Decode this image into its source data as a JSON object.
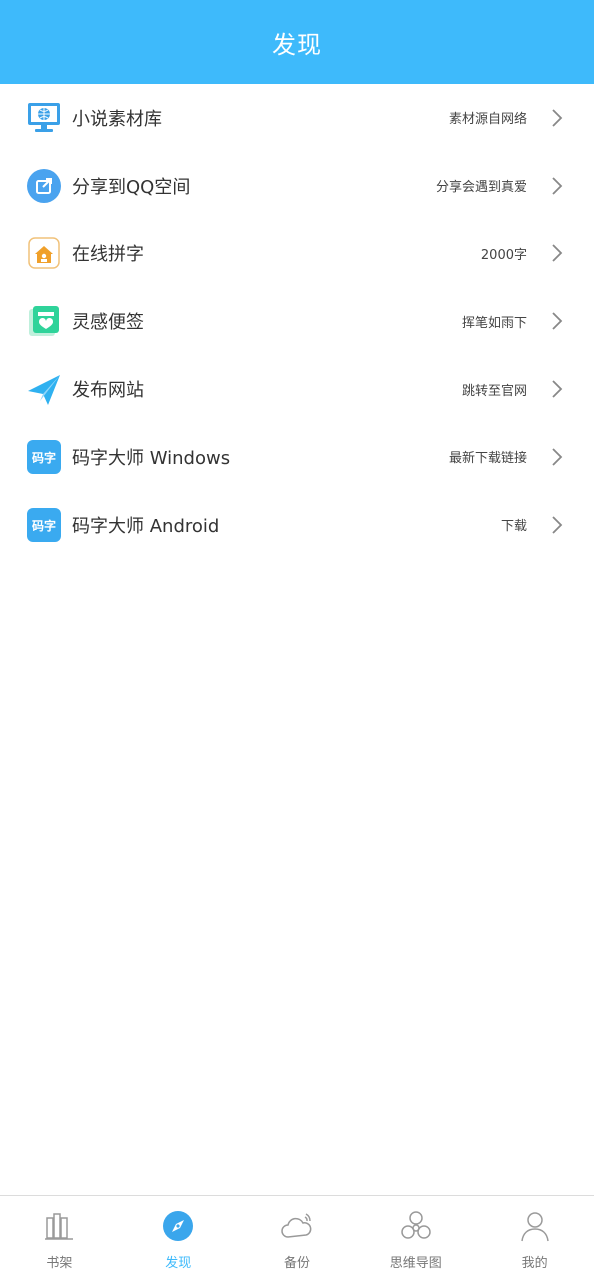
{
  "header": {
    "title": "发现"
  },
  "items": [
    {
      "label": "小说素材库",
      "hint": "素材源自网络"
    },
    {
      "label": "分享到QQ空间",
      "hint": "分享会遇到真爱"
    },
    {
      "label": "在线拼字",
      "hint": "2000字"
    },
    {
      "label": "灵感便签",
      "hint": "挥笔如雨下"
    },
    {
      "label": "发布网站",
      "hint": "跳转至官网"
    },
    {
      "label": "码字大师 Windows",
      "hint": "最新下载链接"
    },
    {
      "label": "码字大师 Android",
      "hint": "下载"
    }
  ],
  "app_logo_text": "码字",
  "tabs": [
    {
      "label": "书架"
    },
    {
      "label": "发现"
    },
    {
      "label": "备份"
    },
    {
      "label": "思维导图"
    },
    {
      "label": "我的"
    }
  ],
  "colors": {
    "accent": "#3ebafb",
    "header_bg": "#3ebafb"
  }
}
